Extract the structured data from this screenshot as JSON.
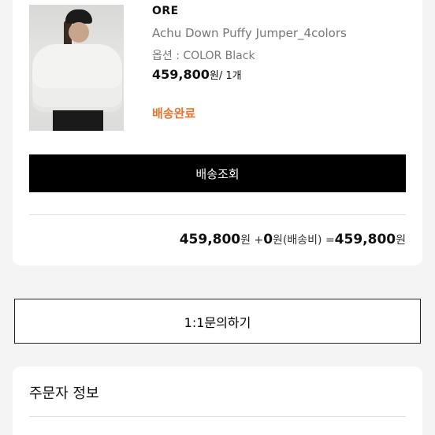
{
  "order_item": {
    "brand": "ORE",
    "product_name": "Achu Down Puffy Jumper_4colors",
    "option_label": "옵션 : COLOR Black",
    "price": "459,800",
    "price_unit": "원/ 1개",
    "status": "배송완료",
    "track_button": "배송조회",
    "image_alt": "white puffy down jumper product photo"
  },
  "summary": {
    "product_total": "459,800",
    "won1": "원 +",
    "shipping": "0",
    "shipping_suffix": "원(배송비) =",
    "grand_total": "459,800",
    "won2": "원"
  },
  "inquiry_button": "1:1문의하기",
  "orderer": {
    "title": "주문자 정보"
  },
  "colors": {
    "status": "#e8742f",
    "button_bg": "#000000"
  }
}
